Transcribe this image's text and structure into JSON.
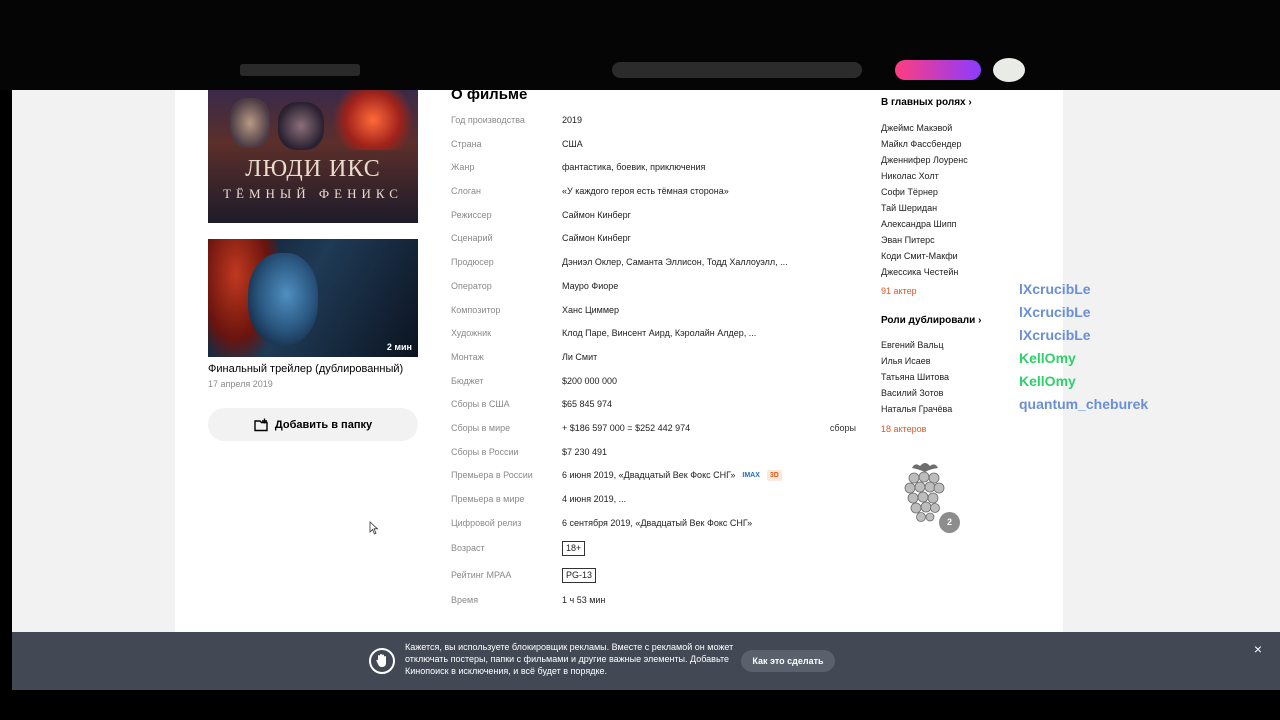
{
  "poster": {
    "title": "ЛЮДИ ИКС",
    "subtitle": "ТЁМНЫЙ ФЕНИКС"
  },
  "trailer": {
    "duration": "2 мин",
    "title": "Финальный трейлер (дублированный)",
    "date": "17 апреля 2019"
  },
  "add_folder_label": "Добавить в папку",
  "about": {
    "title": "О фильме",
    "rows": [
      {
        "label": "Год производства",
        "value": "2019"
      },
      {
        "label": "Страна",
        "value": "США"
      },
      {
        "label": "Жанр",
        "value": "фантастика, боевик, приключения"
      },
      {
        "label": "Слоган",
        "value": "«У каждого героя есть тёмная сторона»"
      },
      {
        "label": "Режиссер",
        "value": "Саймон Кинберг"
      },
      {
        "label": "Сценарий",
        "value": "Саймон Кинберг"
      },
      {
        "label": "Продюсер",
        "value": "Дэниэл Оклер, Саманта Эллисон, Тодд Халлоуэлл, ..."
      },
      {
        "label": "Оператор",
        "value": "Мауро Фиоре"
      },
      {
        "label": "Композитор",
        "value": "Ханс Циммер"
      },
      {
        "label": "Художник",
        "value": "Клод Паре, Винсент Аирд, Кэролайн Алдер, ..."
      },
      {
        "label": "Монтаж",
        "value": "Ли Смит"
      },
      {
        "label": "Бюджет",
        "value": "$200 000 000"
      },
      {
        "label": "Сборы в США",
        "value": "$65 845 974"
      },
      {
        "label": "Сборы в мире",
        "value": "+ $186 597 000 = $252 442 974",
        "extra": "сборы"
      },
      {
        "label": "Сборы в России",
        "value": "$7 230 491"
      },
      {
        "label": "Премьера в России",
        "value": "6 июня 2019, «Двадцатый Век Фокс СНГ»",
        "badges": [
          "IMAX",
          "3D"
        ]
      },
      {
        "label": "Премьера в мире",
        "value": "4 июня 2019, ..."
      },
      {
        "label": "Цифровой релиз",
        "value": "6 сентября 2019, «Двадцатый Век Фокс СНГ»"
      },
      {
        "label": "Возраст",
        "value": "18+",
        "tag": true
      },
      {
        "label": "Рейтинг MPAA",
        "value": "PG-13",
        "tag": true
      },
      {
        "label": "Время",
        "value": "1 ч 53 мин"
      }
    ]
  },
  "cast": {
    "heading": "В главных ролях",
    "items": [
      "Джеймс Макэвой",
      "Майкл Фассбендер",
      "Дженнифер Лоуренс",
      "Николас Холт",
      "Софи Тёрнер",
      "Тай Шеридан",
      "Александра Шипп",
      "Эван Питерс",
      "Коди Смит-Макфи",
      "Джессика Честейн"
    ],
    "more": "91 актер"
  },
  "dubbing": {
    "heading": "Роли дублировали",
    "items": [
      "Евгений Вальц",
      "Илья Исаев",
      "Татьяна Шитова",
      "Василий Зотов",
      "Наталья Грачёва"
    ],
    "more": "18 актеров"
  },
  "award_count": "2",
  "chat": [
    {
      "nick": "lXcrucibLe",
      "color": "#6a8fd6",
      "text": ""
    },
    {
      "nick": "lXcrucibLe",
      "color": "#6a8fd6",
      "text": ""
    },
    {
      "nick": "lXcrucibLe",
      "color": "#6a8fd6",
      "text": ""
    },
    {
      "nick": "KellOmy",
      "color": "#2fd06a",
      "text": ""
    },
    {
      "nick": "KellOmy",
      "color": "#2fd06a",
      "text": ""
    },
    {
      "nick": "quantum_cheburek",
      "color": "#6a8fd6",
      "text": ""
    }
  ],
  "banner": {
    "text": "Кажется, вы используете блокировщик рекламы. Вместе с рекламой он может отключать постеры, папки с фильмами и другие важные элементы. Добавьте Кинопоиск в исключения, и всё будет в порядке.",
    "button": "Как это сделать",
    "close": "×"
  }
}
